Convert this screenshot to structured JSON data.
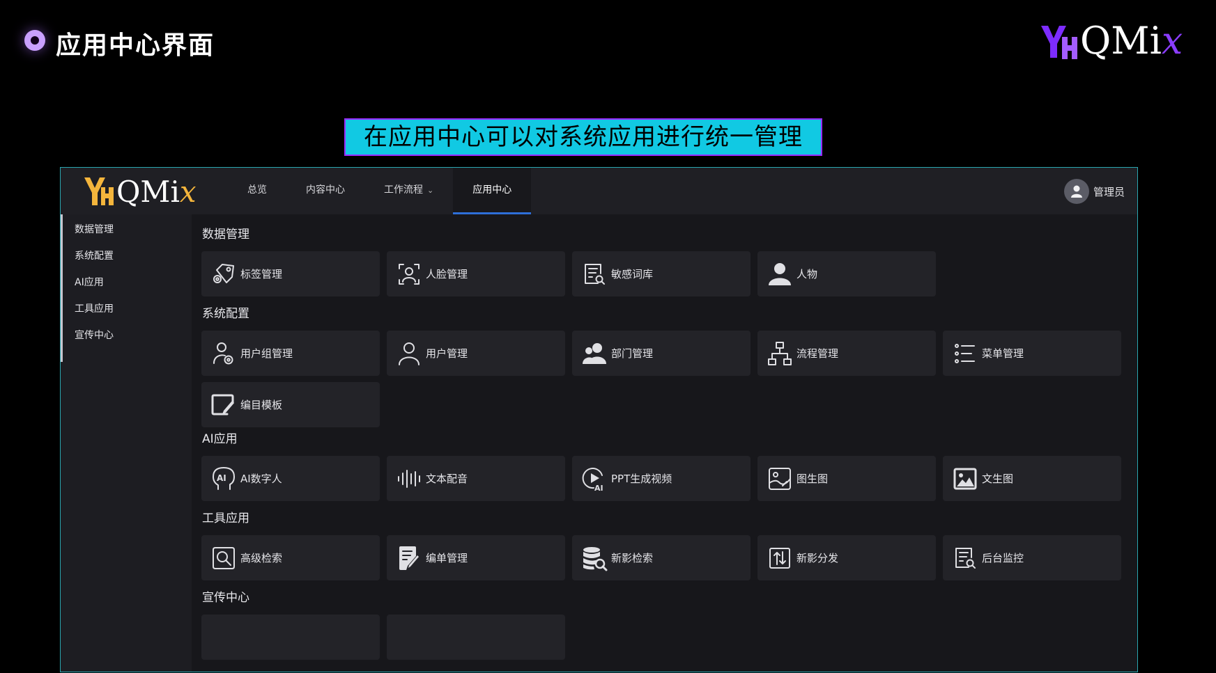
{
  "slide": {
    "title": "应用中心界面",
    "brand": {
      "main": "QMi",
      "accent": "x"
    },
    "banner": "在应用中心可以对系统应用进行统一管理"
  },
  "app": {
    "logo": {
      "main": "QMi",
      "accent": "x"
    },
    "nav": [
      "总览",
      "内容中心",
      "工作流程",
      "应用中心"
    ],
    "user": "管理员",
    "sidebar": [
      "数据管理",
      "系统配置",
      "AI应用",
      "工具应用",
      "宣传中心"
    ],
    "sections": [
      {
        "title": "数据管理",
        "items": [
          {
            "label": "标签管理",
            "icon": "tags-icon"
          },
          {
            "label": "人脸管理",
            "icon": "face-scan-icon"
          },
          {
            "label": "敏感词库",
            "icon": "document-search-icon"
          },
          {
            "label": "人物",
            "icon": "person-icon"
          }
        ]
      },
      {
        "title": "系统配置",
        "items": [
          {
            "label": "用户组管理",
            "icon": "user-gear-icon"
          },
          {
            "label": "用户管理",
            "icon": "user-icon"
          },
          {
            "label": "部门管理",
            "icon": "users-icon"
          },
          {
            "label": "流程管理",
            "icon": "hierarchy-icon"
          },
          {
            "label": "菜单管理",
            "icon": "list-icon"
          },
          {
            "label": "编目模板",
            "icon": "edit-window-icon"
          }
        ]
      },
      {
        "title": "AI应用",
        "items": [
          {
            "label": "AI数字人",
            "icon": "ai-head-icon"
          },
          {
            "label": "文本配音",
            "icon": "audio-wave-icon"
          },
          {
            "label": "PPT生成视频",
            "icon": "play-ai-icon"
          },
          {
            "label": "图生图",
            "icon": "image-edit-icon"
          },
          {
            "label": "文生图",
            "icon": "image-icon"
          }
        ]
      },
      {
        "title": "工具应用",
        "items": [
          {
            "label": "高级检索",
            "icon": "search-box-icon"
          },
          {
            "label": "编单管理",
            "icon": "note-edit-icon"
          },
          {
            "label": "新影检索",
            "icon": "database-search-icon"
          },
          {
            "label": "新影分发",
            "icon": "sort-arrows-icon"
          },
          {
            "label": "后台监控",
            "icon": "monitor-list-icon"
          }
        ]
      },
      {
        "title": "宣传中心",
        "items": []
      }
    ]
  },
  "colors": {
    "banner": "#11c9e3",
    "accent_purple": "#8b3dff",
    "accent_gold": "#f4b53c",
    "nav_active": "#2e6fd8"
  }
}
